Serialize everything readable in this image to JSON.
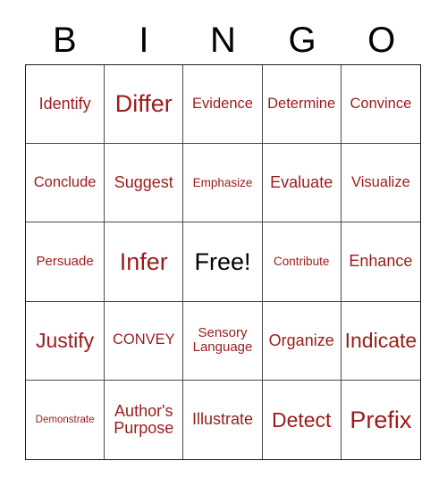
{
  "card": {
    "header": {
      "letters": [
        "B",
        "I",
        "N",
        "G",
        "O"
      ]
    },
    "colors": {
      "text_red": "#9B1B1B",
      "free_space_black": "#000000",
      "grid_line": "#4a4a4a",
      "outer_border": "#1a1a1a",
      "background": "#ffffff"
    },
    "rows": [
      [
        {
          "label": "Identify",
          "size": "ml"
        },
        {
          "label": "Differ",
          "size": "xxl"
        },
        {
          "label": "Evidence",
          "size": "m"
        },
        {
          "label": "Determine",
          "size": "m"
        },
        {
          "label": "Convince",
          "size": "m"
        }
      ],
      [
        {
          "label": "Conclude",
          "size": "m"
        },
        {
          "label": "Suggest",
          "size": "ml"
        },
        {
          "label": "Emphasize",
          "size": "s"
        },
        {
          "label": "Evaluate",
          "size": "ml"
        },
        {
          "label": "Visualize",
          "size": "m"
        }
      ],
      [
        {
          "label": "Persuade",
          "size": "sm"
        },
        {
          "label": "Infer",
          "size": "xxl"
        },
        {
          "label": "Free!",
          "size": "xxl",
          "free": true
        },
        {
          "label": "Contribute",
          "size": "s"
        },
        {
          "label": "Enhance",
          "size": "ml"
        }
      ],
      [
        {
          "label": "Justify",
          "size": "xl"
        },
        {
          "label": "CONVEY",
          "size": "m"
        },
        {
          "label": "Sensory\nLanguage",
          "size": "sm"
        },
        {
          "label": "Organize",
          "size": "ml"
        },
        {
          "label": "Indicate",
          "size": "xl"
        }
      ],
      [
        {
          "label": "Demonstrate",
          "size": "xs"
        },
        {
          "label": "Author's\nPurpose",
          "size": "ml"
        },
        {
          "label": "Illustrate",
          "size": "ml"
        },
        {
          "label": "Detect",
          "size": "xl"
        },
        {
          "label": "Prefix",
          "size": "xxl"
        }
      ]
    ]
  }
}
